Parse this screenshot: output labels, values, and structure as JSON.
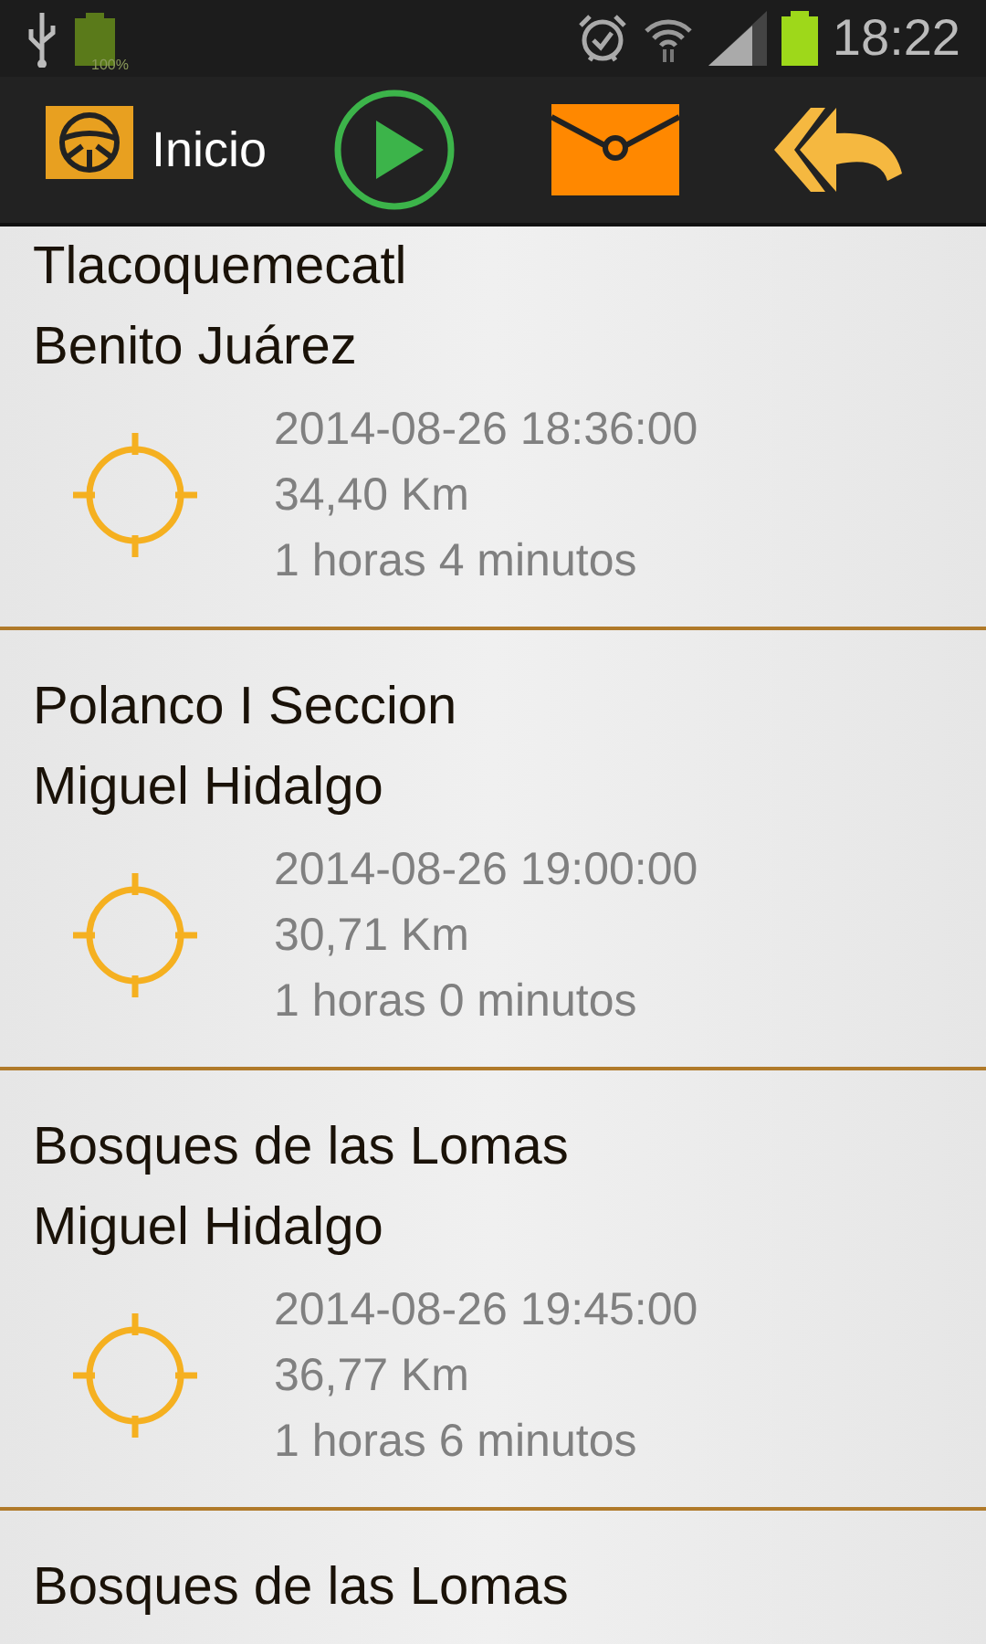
{
  "status_bar": {
    "battery_text": "100%",
    "time": "18:22"
  },
  "action_bar": {
    "title": "Inicio"
  },
  "trips": [
    {
      "place": "Tlacoquemecatl",
      "borough": "Benito Juárez",
      "datetime": "2014-08-26 18:36:00",
      "distance": "34,40 Km",
      "duration": "1 horas 4 minutos"
    },
    {
      "place": "Polanco I Seccion",
      "borough": "Miguel Hidalgo",
      "datetime": "2014-08-26 19:00:00",
      "distance": "30,71 Km",
      "duration": "1 horas 0 minutos"
    },
    {
      "place": "Bosques de las Lomas",
      "borough": "Miguel Hidalgo",
      "datetime": "2014-08-26 19:45:00",
      "distance": "36,77 Km",
      "duration": "1 horas 6 minutos"
    },
    {
      "place": "Bosques de las Lomas"
    }
  ]
}
